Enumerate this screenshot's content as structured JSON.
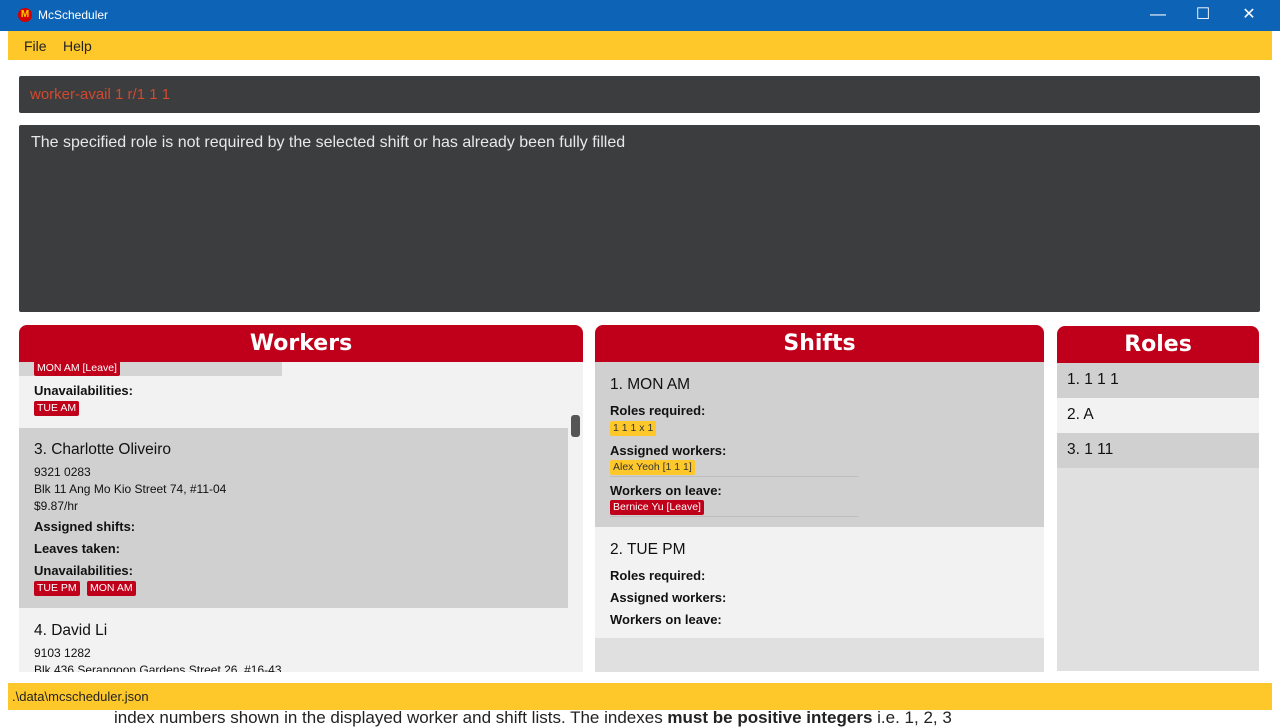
{
  "window": {
    "title": "McScheduler",
    "icon": "mcdonalds-logo",
    "minimize": "—",
    "maximize": "☐",
    "close": "✕"
  },
  "menu": {
    "file": "File",
    "help": "Help"
  },
  "command": {
    "value": "worker-avail 1 r/1 1 1"
  },
  "result": {
    "text": "The specified role is not required by the selected shift or has already been fully filled"
  },
  "workers": {
    "header": "Workers",
    "partial": {
      "leave_tag": "MON AM [Leave]",
      "unavail_label": "Unavailabilities:",
      "unavail": [
        "TUE AM"
      ]
    },
    "items": [
      {
        "name": "3.  Charlotte Oliveiro",
        "phone": "9321 0283",
        "address": "Blk 11 Ang Mo Kio Street 74, #11-04",
        "pay": "$9.87/hr",
        "assigned_label": "Assigned shifts:",
        "leaves_label": "Leaves taken:",
        "unavail_label": "Unavailabilities:",
        "unavail": [
          "TUE PM",
          "MON AM"
        ]
      },
      {
        "name": "4.  David Li",
        "phone": "9103 1282",
        "address": "Blk 436 Serangoon Gardens Street 26, #16-43"
      }
    ]
  },
  "shifts": {
    "header": "Shifts",
    "items": [
      {
        "name": "1.  MON AM",
        "roles_label": "Roles required:",
        "roles": [
          "1 1 1 x 1"
        ],
        "assigned_label": "Assigned workers:",
        "assigned": [
          "Alex Yeoh [1 1 1]"
        ],
        "leave_label": "Workers on leave:",
        "leave": [
          "Bernice Yu [Leave]"
        ]
      },
      {
        "name": "2.  TUE PM",
        "roles_label": "Roles required:",
        "assigned_label": "Assigned workers:",
        "leave_label": "Workers on leave:"
      }
    ]
  },
  "roles": {
    "header": "Roles",
    "items": [
      "1.  1 1 1",
      "2.  A",
      "3.  1 11"
    ]
  },
  "status": {
    "path": ".\\data\\mcscheduler.json"
  },
  "background_peek": {
    "text_before": "index numbers shown in the displayed worker and shift lists. The indexes ",
    "text_bold": "must be positive integers",
    "text_after": " i.e. 1, 2, 3"
  },
  "colors": {
    "titlebar": "#0d63b5",
    "accent_yellow": "#ffc82a",
    "accent_red": "#c0001a",
    "dark_box": "#3c3d3f",
    "command_text": "#d1492e"
  }
}
